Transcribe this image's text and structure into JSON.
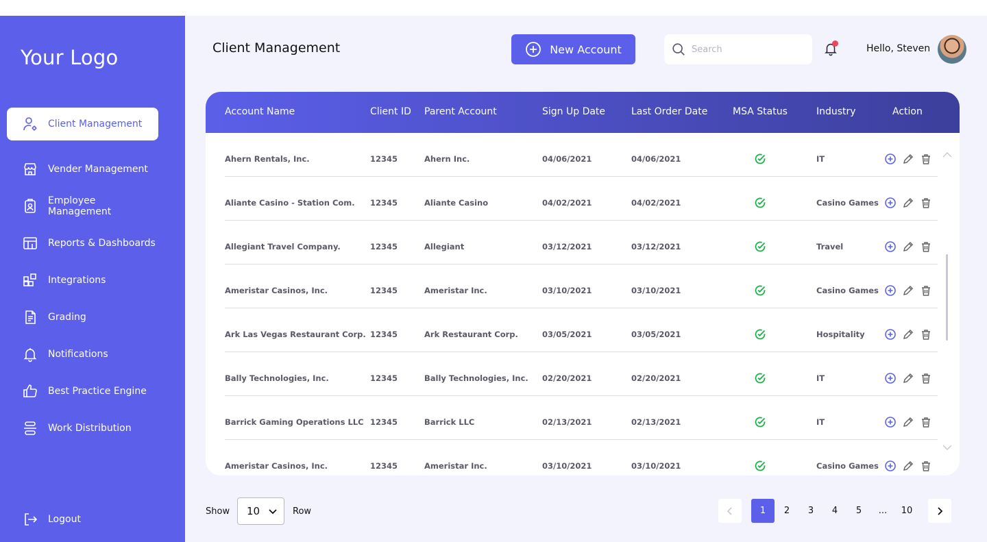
{
  "brand": {
    "logo_text": "Your Logo",
    "accent": "#5b5fe9"
  },
  "sidebar": {
    "items": [
      {
        "label": "Client Management",
        "icon": "user-gear-icon",
        "active": true
      },
      {
        "label": "Vender Management",
        "icon": "store-icon"
      },
      {
        "label": "Employee Management",
        "icon": "id-badge-icon"
      },
      {
        "label": "Reports & Dashboards",
        "icon": "dashboard-icon"
      },
      {
        "label": "Integrations",
        "icon": "integrations-icon"
      },
      {
        "label": "Grading",
        "icon": "document-icon"
      },
      {
        "label": "Notifications",
        "icon": "bell-icon"
      },
      {
        "label": "Best Practice Engine",
        "icon": "thumbs-up-icon"
      },
      {
        "label": "Work Distribution",
        "icon": "distribution-icon"
      }
    ],
    "logout_label": "Logout"
  },
  "header": {
    "title": "Client Management",
    "new_account_label": "New Account",
    "search_placeholder": "Search",
    "greeting": "Hello, Steven",
    "notification_badge_color": "#f0455c"
  },
  "table": {
    "columns": [
      "Account Name",
      "Client ID",
      "Parent Account",
      "Sign Up Date",
      "Last Order Date",
      "MSA Status",
      "Industry",
      "Action"
    ],
    "rows": [
      {
        "account": "Ahern Rentals, Inc.",
        "client_id": "12345",
        "parent": "Ahern Inc.",
        "signup": "04/06/2021",
        "last_order": "04/06/2021",
        "msa": "active",
        "industry": "IT"
      },
      {
        "account": "Aliante Casino - Station Com.",
        "client_id": "12345",
        "parent": "Aliante Casino",
        "signup": "04/02/2021",
        "last_order": "04/02/2021",
        "msa": "active",
        "industry": "Casino Games"
      },
      {
        "account": "Allegiant Travel Company.",
        "client_id": "12345",
        "parent": "Allegiant",
        "signup": "03/12/2021",
        "last_order": "03/12/2021",
        "msa": "active",
        "industry": "Travel"
      },
      {
        "account": "Ameristar Casinos, Inc.",
        "client_id": "12345",
        "parent": "Ameristar Inc.",
        "signup": "03/10/2021",
        "last_order": "03/10/2021",
        "msa": "active",
        "industry": "Casino Games"
      },
      {
        "account": "Ark Las Vegas Restaurant Corp.",
        "client_id": "12345",
        "parent": "Ark Restaurant Corp.",
        "signup": "03/05/2021",
        "last_order": "03/05/2021",
        "msa": "active",
        "industry": "Hospitality"
      },
      {
        "account": "Bally Technologies, Inc.",
        "client_id": "12345",
        "parent": "Bally Technologies, Inc.",
        "signup": "02/20/2021",
        "last_order": "02/20/2021",
        "msa": "active",
        "industry": "IT"
      },
      {
        "account": "Barrick Gaming Operations LLC",
        "client_id": "12345",
        "parent": "Barrick LLC",
        "signup": "02/13/2021",
        "last_order": "02/13/2021",
        "msa": "active",
        "industry": "IT"
      },
      {
        "account": "Ameristar Casinos, Inc.",
        "client_id": "12345",
        "parent": "Ameristar Inc.",
        "signup": "03/10/2021",
        "last_order": "03/10/2021",
        "msa": "active",
        "industry": "Casino Games"
      }
    ],
    "status_color": "#22b14c",
    "action_icons": [
      "add-circle-icon",
      "edit-pencil-icon",
      "trash-icon"
    ]
  },
  "footer": {
    "show_label": "Show",
    "rows_per_page": "10",
    "row_label": "Row",
    "pages": [
      "1",
      "2",
      "3",
      "4",
      "5",
      "...",
      "10"
    ],
    "current_page": "1"
  }
}
